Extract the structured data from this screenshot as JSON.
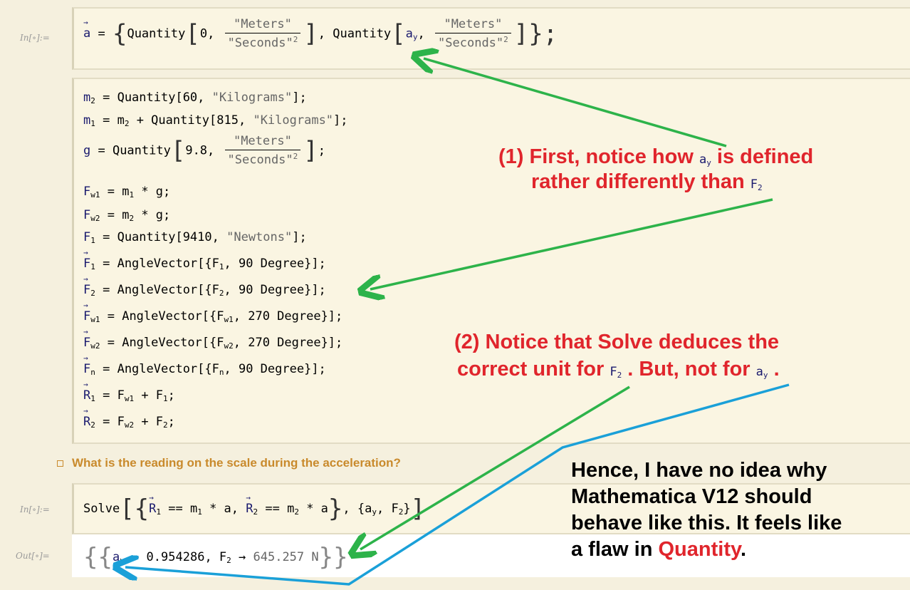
{
  "labels": {
    "in1": "In[∘]:=",
    "in2": "In[∘]:=",
    "out": "Out[∘]="
  },
  "cell1": {
    "a_vec": "a",
    "eq": " = ",
    "open": "{",
    "q1": "Quantity",
    "q1_val": "0,",
    "q1_num": "\"Meters\"",
    "q1_den": "\"Seconds\"",
    "q1_pow": "2",
    "comma": ", ",
    "q2": "Quantity",
    "q2_val_base": "a",
    "q2_val_sub": "y",
    "q2_num": "\"Meters\"",
    "q2_den": "\"Seconds\"",
    "q2_pow": "2",
    "close": "};"
  },
  "cell2": {
    "lines": [
      {
        "lhs": "m",
        "lhs_sub": "2",
        "rhs": " = Quantity[60, ",
        "str": "\"Kilograms\"",
        "end": "];"
      },
      {
        "lhs": "m",
        "lhs_sub": "1",
        "rhs": " = m",
        "rhs_sub": "2",
        "rhs2": " + Quantity[815, ",
        "str": "\"Kilograms\"",
        "end": "];"
      },
      {
        "lhs": "F",
        "lhs_sub": "w1",
        "rhs": " = m",
        "rhs_sub": "1",
        "rhs2": " * g;"
      },
      {
        "lhs": "F",
        "lhs_sub": "w2",
        "rhs": " = m",
        "rhs_sub": "2",
        "rhs2": " * g;"
      },
      {
        "lhs": "F",
        "lhs_sub": "1",
        "rhs": " = Quantity[9410, ",
        "str": "\"Newtons\"",
        "end": "];"
      },
      {
        "lhs": "F",
        "lhs_sub": "1",
        "rhs": " = AngleVector[{F",
        "rhs_sub": "1",
        "rhs2": ", 90 Degree}];"
      },
      {
        "lhs": "F",
        "lhs_sub": "2",
        "rhs": " = AngleVector[{F",
        "rhs_sub": "2",
        "rhs2": ", 90 Degree}];"
      },
      {
        "lhs": "F",
        "lhs_sub": "w1",
        "rhs": " = AngleVector[{F",
        "rhs_sub": "w1",
        "rhs2": ", 270 Degree}];"
      },
      {
        "lhs": "F",
        "lhs_sub": "w2",
        "rhs": " = AngleVector[{F",
        "rhs_sub": "w2",
        "rhs2": ", 270 Degree}];"
      },
      {
        "lhs": "F",
        "lhs_sub": "n",
        "rhs": " = AngleVector[{F",
        "rhs_sub": "n",
        "rhs2": ", 90 Degree}];"
      },
      {
        "lhs": "R",
        "lhs_sub": "1",
        "rhs": " = F",
        "rhs_sub": "w1",
        "rhs2": " + F",
        "rhs2_sub": "1",
        "end": ";"
      },
      {
        "lhs": "R",
        "lhs_sub": "2",
        "rhs": " = F",
        "rhs_sub": "w2",
        "rhs2": " + F",
        "rhs2_sub": "2",
        "end": ";"
      }
    ],
    "g_line": {
      "lhs": "g",
      "eq": " = Quantity",
      "val": "9.8,",
      "num": "\"Meters\"",
      "den": "\"Seconds\"",
      "pow": "2",
      "end": ";"
    }
  },
  "section_title": "What is the reading on the scale during the acceleration?",
  "solve": {
    "fn": "Solve",
    "r1": "R",
    "r1_sub": "1",
    "eq1": " == m",
    "eq1_sub": "1",
    "times1": " * a",
    "r2": "R",
    "r2_sub": "2",
    "eq2": " == m",
    "eq2_sub": "2",
    "times2": " * a",
    "vars": "{a",
    "vars_sub": "y",
    "vars2": ", F",
    "vars2_sub": "2",
    "vars_end": "}"
  },
  "output": {
    "open": "{{",
    "a": "a",
    "a_sub": "y",
    "arrow1": " → ",
    "a_val": "0.954286",
    "f": ", F",
    "f_sub": "2",
    "arrow2": " → ",
    "f_val": "645.257 N",
    "close": "}}"
  },
  "annotations": {
    "note1_line1": "(1) First, notice how",
    "note1_ay": "a",
    "note1_ay_sub": "y",
    "note1_line1_end": "is defined",
    "note1_line2": "rather differently than",
    "note1_f2": "F",
    "note1_f2_sub": "2",
    "note2_line1": "(2) Notice that Solve deduces the",
    "note2_line2a": "correct unit for",
    "note2_f2": "F",
    "note2_f2_sub": "2",
    "note2_line2b": ". But, not for",
    "note2_ay": "a",
    "note2_ay_sub": "y",
    "note2_end": ".",
    "note3_line1": "Hence, I have no idea why",
    "note3_line2": "Mathematica V12 should",
    "note3_line3": "behave like this. It feels like",
    "note3_line4a": "a flaw in ",
    "note3_quantity": "Quantity",
    "note3_end": "."
  },
  "colors": {
    "green_arrow": "#2db34a",
    "blue_arrow": "#1aa0d8",
    "red_text": "#e0252c",
    "section": "#c98a2c"
  }
}
